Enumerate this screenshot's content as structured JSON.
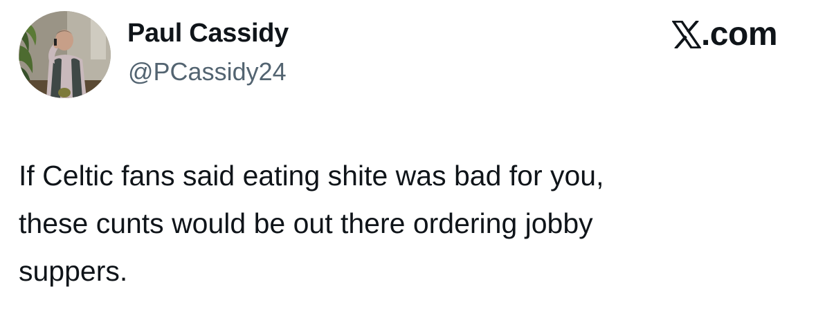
{
  "author": {
    "display_name": "Paul Cassidy",
    "handle": "@PCassidy24",
    "avatar_icon": "profile-photo"
  },
  "brand": {
    "label": ".com",
    "logo_icon": "x-logo-icon"
  },
  "tweet": {
    "lines": [
      "If Celtic fans said eating shite was bad for you,",
      "these cunts would be out there ordering jobby",
      "suppers."
    ]
  },
  "colors": {
    "text_primary": "#0f1419",
    "text_secondary": "#536471",
    "background": "#ffffff"
  }
}
